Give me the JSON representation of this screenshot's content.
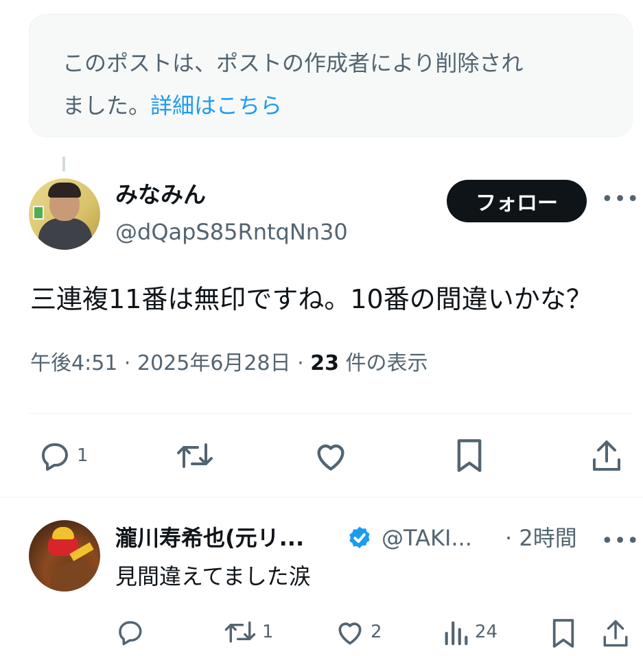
{
  "deleted_notice": {
    "text_line1": "このポストは、ポストの作成者により削除され",
    "text_line2": "ました。",
    "link": "詳細はこちら"
  },
  "tweet": {
    "author_name": "みなみん",
    "author_handle": "@dQapS85RntqNn30",
    "follow_label": "フォロー",
    "text": "三連複11番は無印ですね。10番の間違いかな？",
    "time": "午後4:51",
    "sep1": " · ",
    "date": "2025年6月28日",
    "sep2": " · ",
    "views_count": "23",
    "views_label": " 件の表示",
    "reply_count": "1"
  },
  "reply": {
    "author_name": "瀧川寿希也(元リ...",
    "author_handle": "@TAKI...",
    "time": "· 2時間",
    "text": "見間違えてました涙",
    "retweet_count": "1",
    "like_count": "2",
    "views_count": "24"
  },
  "colors": {
    "accent": "#1d9bf0",
    "text_primary": "#0f1419",
    "text_secondary": "#536471",
    "notice_bg": "#f7f9f9"
  },
  "icons": [
    "reply-icon",
    "retweet-icon",
    "like-icon",
    "bookmark-icon",
    "share-icon",
    "views-icon",
    "verified-badge-icon",
    "more-icon"
  ]
}
